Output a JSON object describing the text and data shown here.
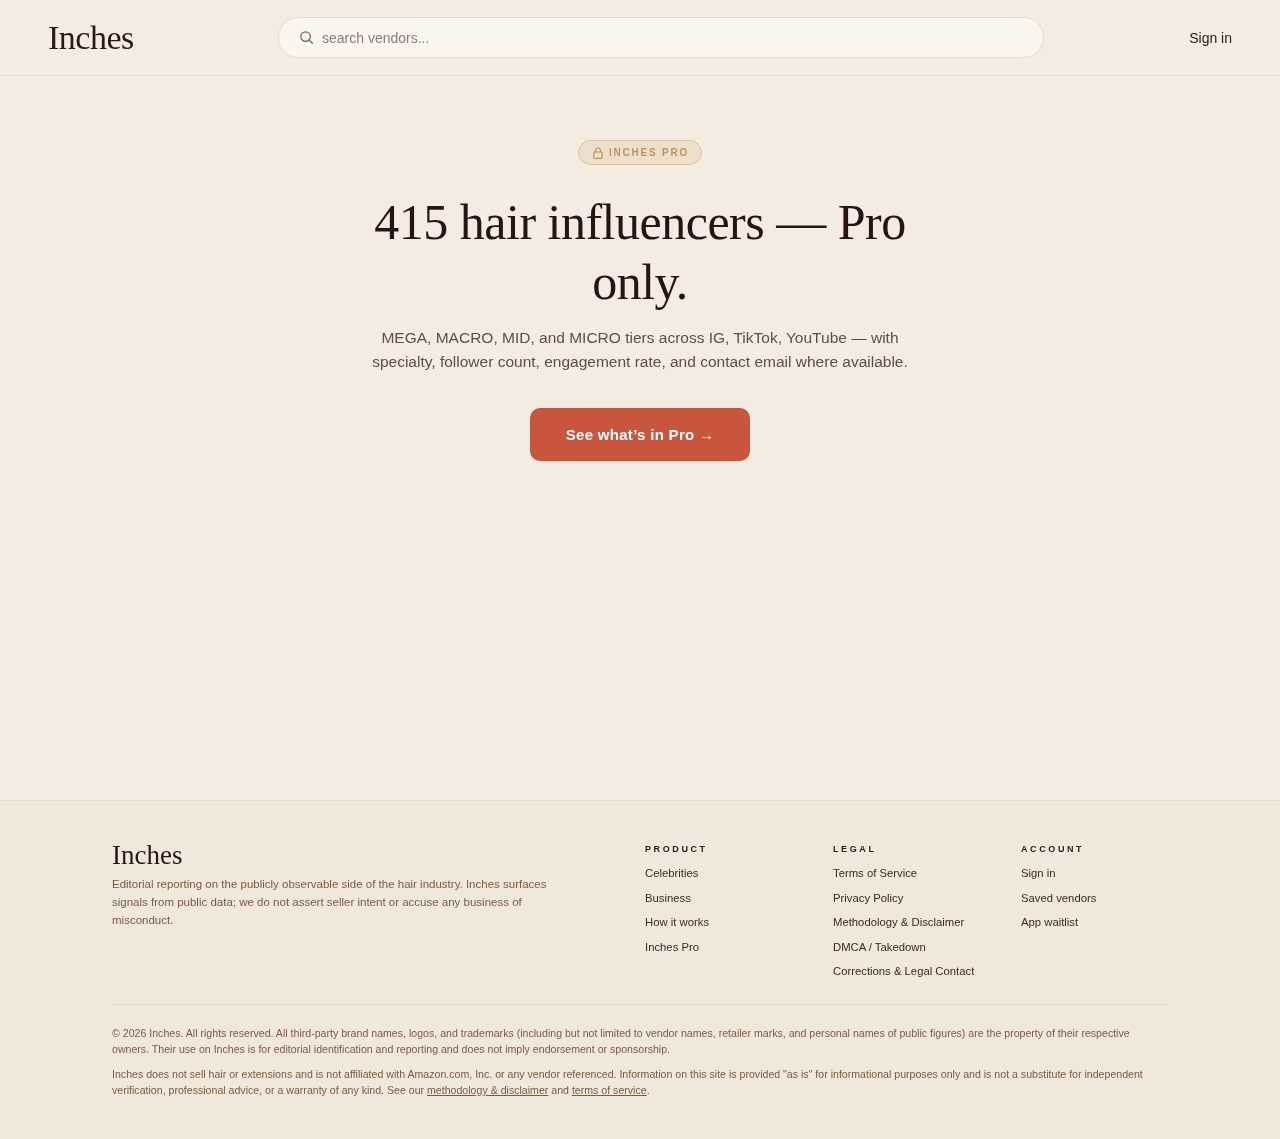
{
  "header": {
    "logo": "Inches",
    "search": {
      "placeholder": "search vendors..."
    },
    "sign_in": "Sign in"
  },
  "hero": {
    "badge": "INCHES PRO",
    "title": "415 hair influencers — Pro only.",
    "description": "MEGA, MACRO, MID, and MICRO tiers across IG, TikTok, YouTube — with specialty, follower count, engagement rate, and contact email where available.",
    "cta": "See what’s in Pro →"
  },
  "footer": {
    "logo": "Inches",
    "tagline": "Editorial reporting on the publicly observable side of the hair industry. Inches surfaces signals from public data; we do not assert seller intent or accuse any business of misconduct.",
    "columns": [
      {
        "heading": "PRODUCT",
        "links": [
          "Celebrities",
          "Business",
          "How it works",
          "Inches Pro"
        ]
      },
      {
        "heading": "LEGAL",
        "links": [
          "Terms of Service",
          "Privacy Policy",
          "Methodology & Disclaimer",
          "DMCA / Takedown",
          "Corrections & Legal Contact"
        ]
      },
      {
        "heading": "ACCOUNT",
        "links": [
          "Sign in",
          "Saved vendors",
          "App waitlist"
        ]
      }
    ],
    "copyright": "© 2026 Inches. All rights reserved. All third-party brand names, logos, and trademarks (including but not limited to vendor names, retailer marks, and personal names of public figures) are the property of their respective owners. Their use on Inches is for editorial identification and reporting and does not imply endorsement or sponsorship.",
    "notice": [
      {
        "kind": "text",
        "text": "Inches does not sell hair or extensions and is not affiliated with Amazon.com, Inc. or any vendor referenced. Information on this site is provided \"as is\" for informational purposes only and is not a substitute for independent verification, professional advice, or a warranty of any kind. See our "
      },
      {
        "kind": "link",
        "text": "methodology & disclaimer"
      },
      {
        "kind": "text",
        "text": " and "
      },
      {
        "kind": "link",
        "text": "terms of service"
      },
      {
        "kind": "text",
        "text": "."
      }
    ]
  }
}
